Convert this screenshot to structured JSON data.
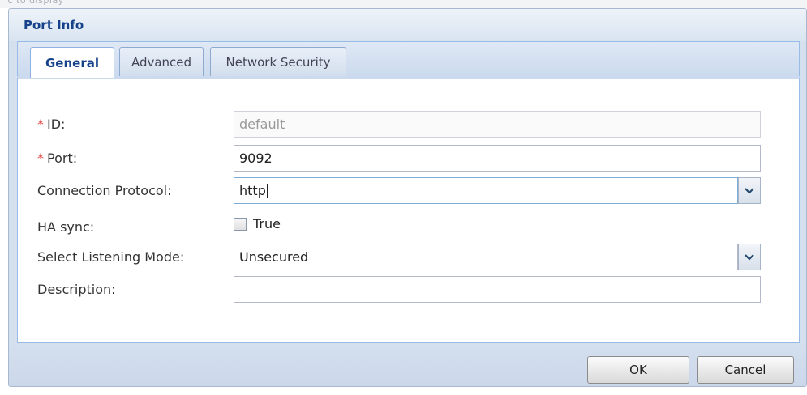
{
  "dialog": {
    "title": "Port Info"
  },
  "tabs": [
    {
      "label": "General",
      "active": true
    },
    {
      "label": "Advanced",
      "active": false
    },
    {
      "label": "Network Security",
      "active": false
    }
  ],
  "form": {
    "id": {
      "label": "ID:",
      "required_marker": "*",
      "value": "default",
      "disabled": true
    },
    "port": {
      "label": "Port:",
      "required_marker": "*",
      "value": "9092"
    },
    "connection_protocol": {
      "label": "Connection Protocol:",
      "value": "http"
    },
    "ha_sync": {
      "label": "HA sync:",
      "checkbox_label": "True",
      "checked": false
    },
    "listening_mode": {
      "label": "Select Listening Mode:",
      "value": "Unsecured"
    },
    "description": {
      "label": "Description:",
      "value": ""
    }
  },
  "buttons": {
    "ok": "OK",
    "cancel": "Cancel"
  },
  "icons": {
    "dropdown": "chevron-down-icon"
  },
  "colors": {
    "title": "#15428b",
    "required": "#e04040",
    "frame": "#d5e0ee",
    "tab_border": "#99bbe8"
  }
}
